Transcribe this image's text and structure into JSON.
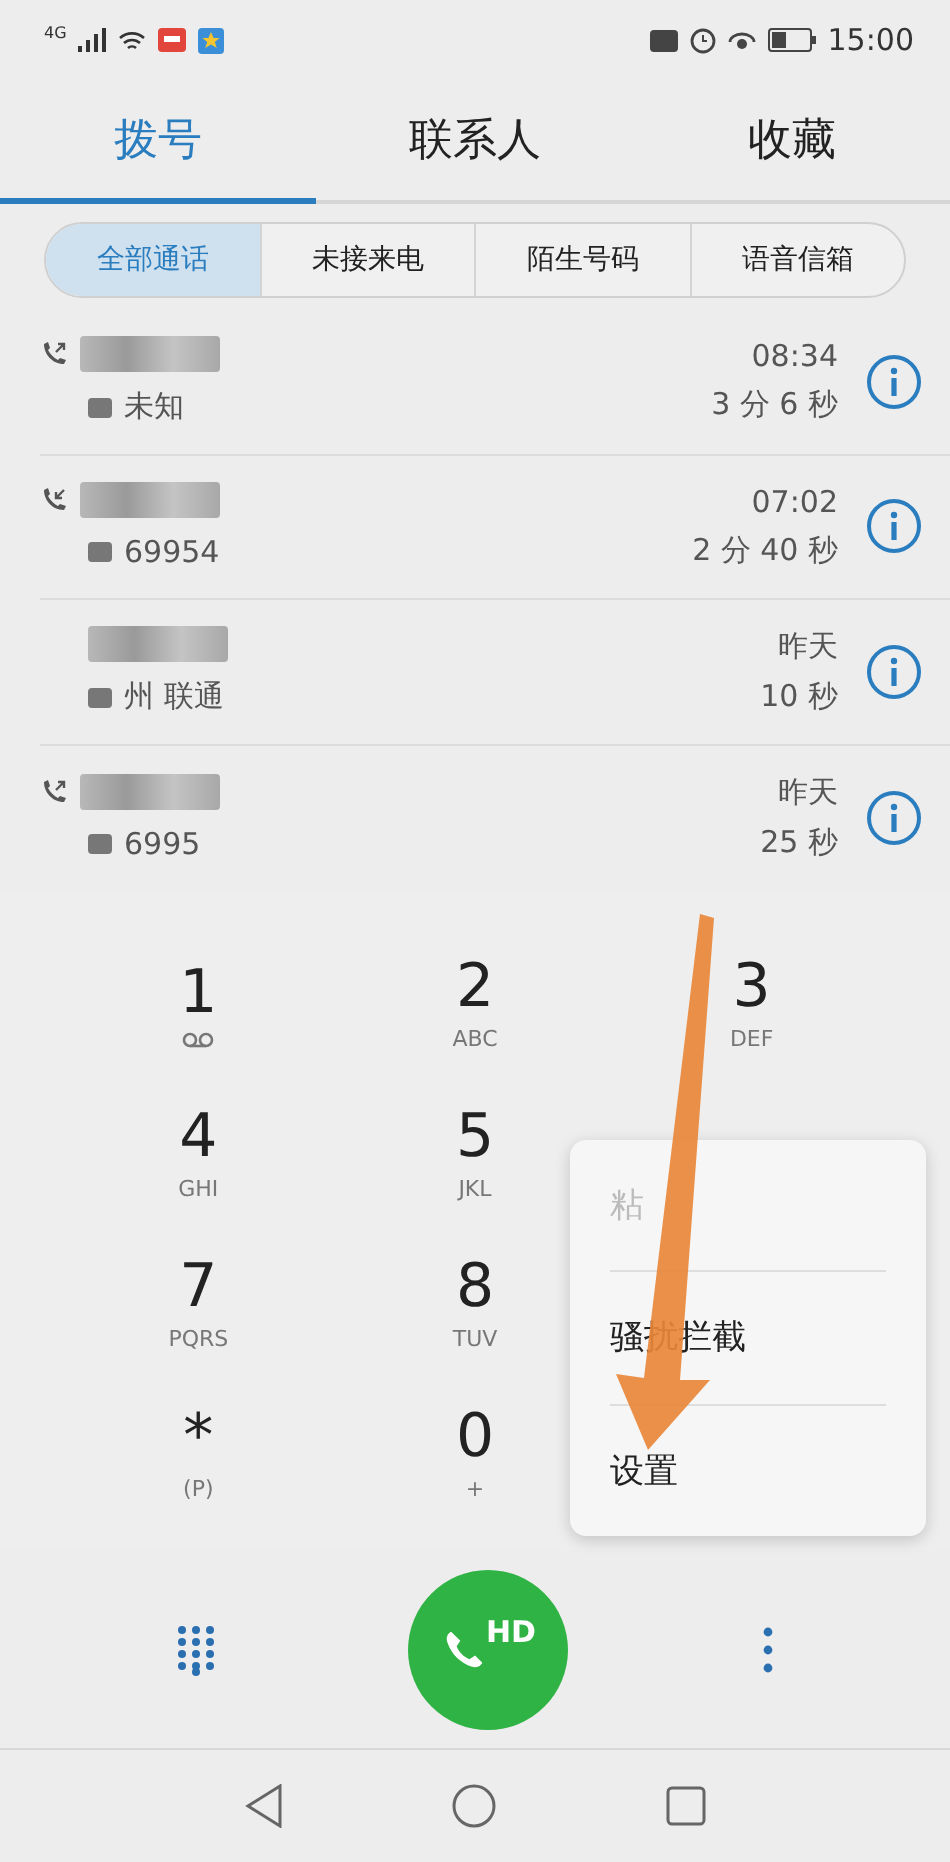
{
  "status_bar": {
    "network": "4G",
    "time": "15:00"
  },
  "tabs": [
    {
      "label": "拨号",
      "selected": true
    },
    {
      "label": "联系人",
      "selected": false
    },
    {
      "label": "收藏",
      "selected": false
    }
  ],
  "filters": [
    {
      "label": "全部通话",
      "selected": true
    },
    {
      "label": "未接来电",
      "selected": false
    },
    {
      "label": "陌生号码",
      "selected": false
    },
    {
      "label": "语音信箱",
      "selected": false
    }
  ],
  "calls": [
    {
      "kind": "outgoing",
      "detail": "未知",
      "time": "08:34",
      "duration": "3 分 6 秒"
    },
    {
      "kind": "incoming",
      "detail": "69954",
      "time": "07:02",
      "duration": "2 分 40 秒"
    },
    {
      "kind": "obscured",
      "detail": "州 联通",
      "time": "昨天",
      "duration": "10 秒"
    },
    {
      "kind": "outgoing",
      "detail": "6995",
      "time": "昨天",
      "duration": "25 秒"
    }
  ],
  "keypad": [
    [
      {
        "digit": "1",
        "voicemail": true
      },
      {
        "digit": "2",
        "letters": "ABC",
        "voicemail": false
      },
      {
        "digit": "3",
        "letters": "DEF",
        "voicemail": false
      }
    ],
    [
      {
        "digit": "4",
        "letters": "GHI",
        "voicemail": false
      },
      {
        "digit": "5",
        "letters": "JKL",
        "voicemail": false
      }
    ],
    [
      {
        "digit": "7",
        "letters": "PQRS",
        "voicemail": false
      },
      {
        "digit": "8",
        "letters": "TUV",
        "voicemail": false
      }
    ],
    [
      {
        "digit": "*",
        "letters": "(P)",
        "voicemail": false
      },
      {
        "digit": "0",
        "letters": "+",
        "voicemail": false
      }
    ]
  ],
  "call_button": {
    "label": "HD"
  },
  "menu": [
    {
      "label": "粘",
      "disabled": true
    },
    {
      "label": "骚扰拦截",
      "disabled": false
    },
    {
      "label": "设置",
      "disabled": false
    }
  ]
}
